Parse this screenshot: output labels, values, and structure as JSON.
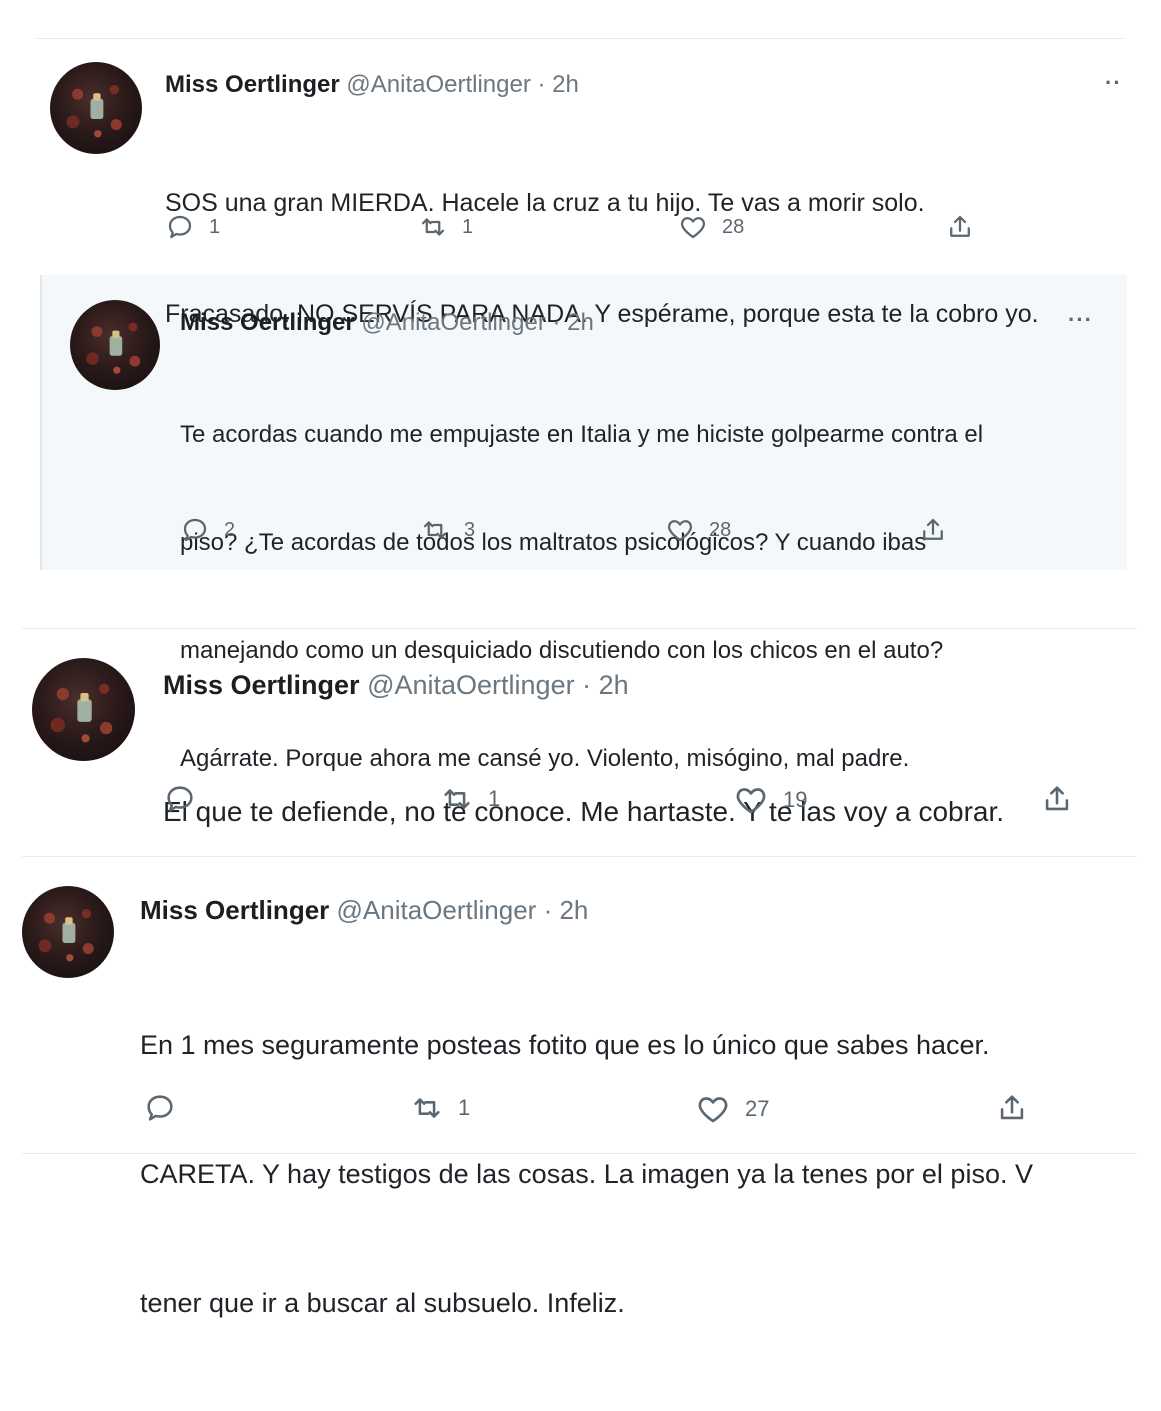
{
  "tweets": [
    {
      "name": "Miss Oertlinger",
      "handle": "@AnitaOertlinger",
      "time": "· 2h",
      "more": "··",
      "lines": [
        "SOS una gran MIERDA. Hacele la cruz a tu hijo. Te vas a morir solo.",
        "Fracasado. NO SERVÍS PARA NADA. Y espérame, porque esta te la cobro yo."
      ],
      "replies": "1",
      "retweets": "1",
      "likes": "28"
    },
    {
      "name": "Miss Oertlinger",
      "handle": "@AnitaOertlinger",
      "time": "· 2h",
      "more": "···",
      "lines": [
        "Te acordas cuando me empujaste en Italia y me hiciste golpearme contra el",
        "piso? ¿Te acordas de todos los maltratos psicológicos? Y cuando ibas",
        "manejando como un desquiciado discutiendo con los chicos en el auto?",
        "Agárrate. Porque ahora me cansé yo. Violento, misógino, mal padre."
      ],
      "replies": "2",
      "retweets": "3",
      "likes": "28"
    },
    {
      "name": "Miss Oertlinger",
      "handle": "@AnitaOertlinger",
      "time": "· 2h",
      "lines": [
        "El que te defiende, no te conoce. Me hartaste. Y te las voy a cobrar."
      ],
      "replies": "",
      "retweets": "1",
      "likes": "19"
    },
    {
      "name": "Miss Oertlinger",
      "handle": "@AnitaOertlinger",
      "time": "· 2h",
      "lines": [
        "En 1 mes seguramente posteas fotito que es lo único que sabes hacer.",
        "CARETA. Y hay testigos de las cosas. La imagen ya la tenes por el piso. V",
        "tener que ir a buscar al subsuelo. Infeliz."
      ],
      "replies": "",
      "retweets": "1",
      "likes": "27"
    }
  ],
  "icons": {
    "reply": "reply-icon",
    "retweet": "retweet-icon",
    "like": "heart-icon",
    "share": "share-icon"
  },
  "colors": {
    "icon_gray": "#5b6770",
    "divider": "#e6ecf0",
    "quote_bg": "#f5f8fa"
  }
}
